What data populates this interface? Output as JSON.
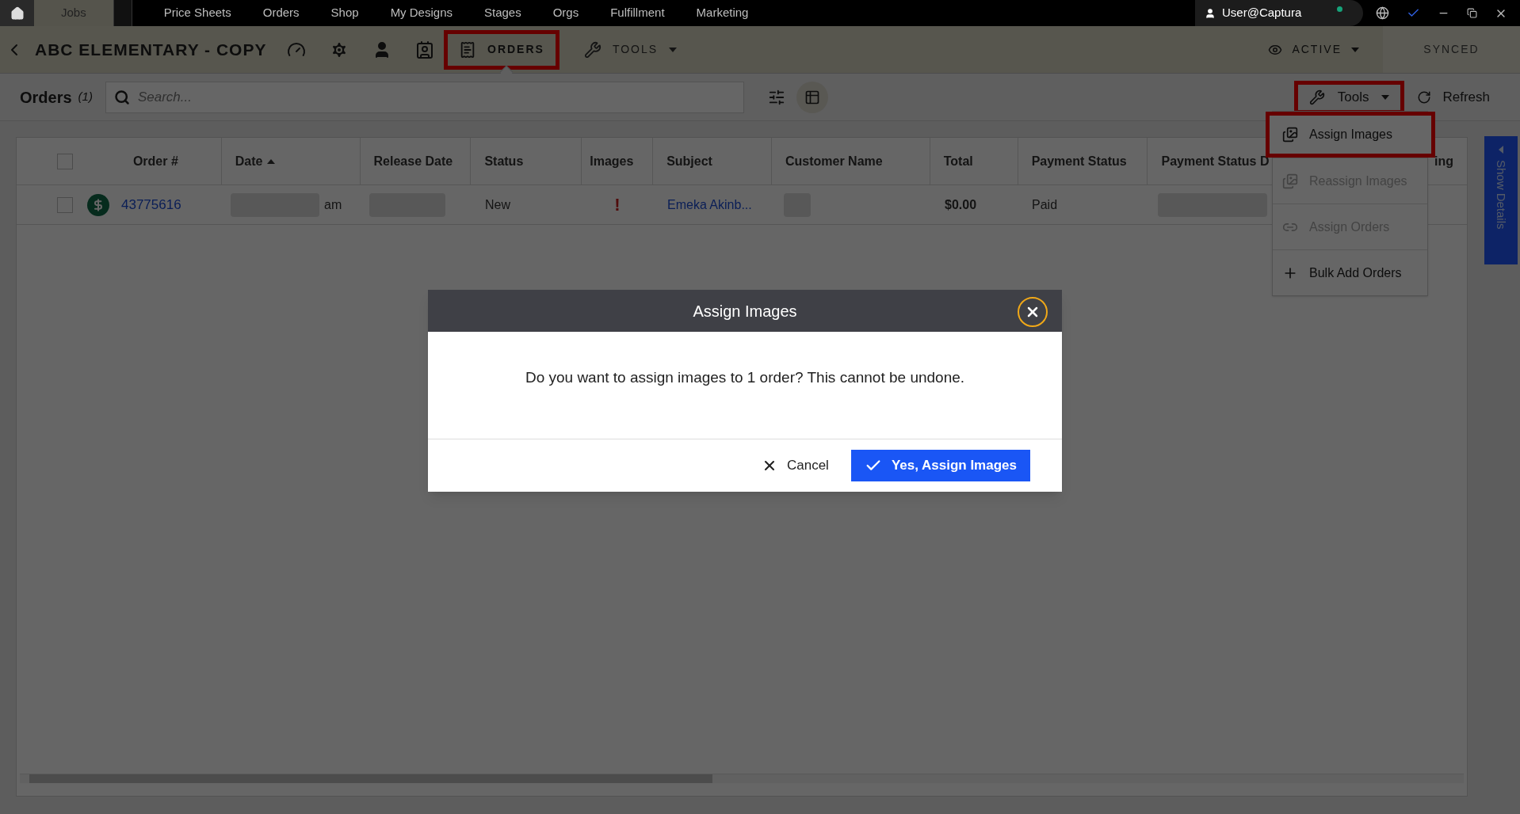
{
  "top_nav": {
    "tabs": [
      {
        "label": "Jobs",
        "selected": true
      },
      {
        "label": "Price Sheets",
        "selected": false
      },
      {
        "label": "Orders",
        "selected": false
      },
      {
        "label": "Shop",
        "selected": false
      },
      {
        "label": "My Designs",
        "selected": false
      },
      {
        "label": "Stages",
        "selected": false
      },
      {
        "label": "Orgs",
        "selected": false
      },
      {
        "label": "Fulfillment",
        "selected": false
      },
      {
        "label": "Marketing",
        "selected": false
      }
    ],
    "user": {
      "name": "User@Captura",
      "online": true
    }
  },
  "job_bar": {
    "title": "ABC ELEMENTARY - COPY",
    "tabs": [
      {
        "label": "ORDERS",
        "selected": true,
        "highlighted": true
      },
      {
        "label": "TOOLS",
        "selected": false,
        "highlighted": false
      }
    ],
    "visibility": "ACTIVE",
    "sync_status": "SYNCED"
  },
  "toolbar": {
    "title": "Orders",
    "count": "(1)",
    "search": {
      "placeholder": "Search..."
    },
    "tools_button": {
      "label": "Tools",
      "highlighted": true
    },
    "refresh_button": {
      "label": "Refresh"
    }
  },
  "tools_menu": [
    {
      "label": "Assign Images",
      "disabled": false,
      "highlighted": true
    },
    {
      "label": "Reassign Images",
      "disabled": true,
      "highlighted": false
    },
    {
      "label": "Assign Orders",
      "disabled": true,
      "highlighted": false
    },
    {
      "label": "Bulk Add Orders",
      "disabled": false,
      "highlighted": false
    }
  ],
  "table": {
    "select_all_checked": false,
    "columns": [
      {
        "label": "Order #",
        "sorted": false
      },
      {
        "label": "Date",
        "sorted": true
      },
      {
        "label": "Release Date",
        "sorted": false
      },
      {
        "label": "Status",
        "sorted": false
      },
      {
        "label": "Images",
        "sorted": false
      },
      {
        "label": "Subject",
        "sorted": false
      },
      {
        "label": "Customer Name",
        "sorted": false
      },
      {
        "label": "Total",
        "sorted": false
      },
      {
        "label": "Payment Status",
        "sorted": false
      },
      {
        "label": "Payment Status D",
        "sorted": false
      },
      {
        "label": "ing",
        "sorted": false
      }
    ],
    "rows": [
      {
        "checked": false,
        "order_number": "43775616",
        "date_suffix": "am",
        "status": "New",
        "images_flag": "!",
        "subject": "Emeka Akinb...",
        "total": "$0.00",
        "payment_status": "Paid"
      }
    ]
  },
  "side_tab": {
    "label": "Show Details"
  },
  "dialog": {
    "title": "Assign Images",
    "message": "Do you want to assign images to 1 order? This cannot be undone.",
    "cancel": "Cancel",
    "confirm": "Yes, Assign Images"
  }
}
